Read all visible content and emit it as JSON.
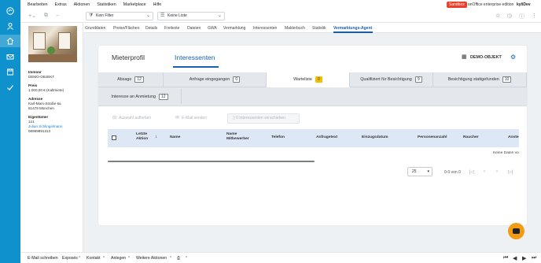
{
  "menubar": {
    "items": [
      "Bearbeiten",
      "Extras",
      "Aktionen",
      "Statistiken",
      "Marketplace",
      "Hilfe"
    ],
    "sandbox": "Sandbox",
    "edition": "onOffice enterprise edition",
    "user": "kyliDev"
  },
  "toolbar": {
    "filter": "Kein Filter",
    "list": "Keine Liste"
  },
  "tabs": [
    "Grunddaten",
    "Preise/Flächen",
    "Details",
    "Freitexte",
    "Dateien",
    "GWA",
    "Vermarktung",
    "Interessenten",
    "Maklerbuch",
    "Statistik",
    "Vermarktungs-Agent"
  ],
  "active_tab": "Vermarktungs-Agent",
  "property": {
    "immonr_label": "Immonr",
    "immonr": "DEMO-OBJEKT",
    "preis_label": "Preis",
    "preis": "1.000,00 € (Kaltmiete)",
    "adresse_label": "Adresse",
    "adresse_1": "Karl-Marx-Straße 6a",
    "adresse_2": "81479 München",
    "eigentuemer_label": "Eigentümer",
    "eig_nr": "121",
    "eig_name": "Julian Schlingelmann",
    "eig_phone": "08989891313"
  },
  "main": {
    "header_tabs": [
      "Mieterprofil",
      "Interessenten"
    ],
    "object_label": "DEMO-OBJEKT"
  },
  "agent_tabs": [
    {
      "label": "Absage",
      "count": "12"
    },
    {
      "label": "Anfrage eingegangen",
      "count": "0"
    },
    {
      "label": "Warteliste",
      "count": "0"
    },
    {
      "label": "Qualifiziert für Besichtigung",
      "count": "9"
    },
    {
      "label": "Besichtigung stattgefunden",
      "count": "10"
    },
    {
      "label": "Interesse an Anmietung",
      "count": "12"
    }
  ],
  "actions": {
    "cancel": "Auswahl aufheben",
    "email": "E-Mail senden",
    "move": "0 Interessenten verschieben"
  },
  "table": {
    "headers": [
      "Letzte Aktion",
      "Name",
      "Name Mitbewerber",
      "Telefon",
      "Anfragetext",
      "Einzugsdatum",
      "Personenanzahl",
      "Raucher",
      "Anste"
    ],
    "nodata": "Keine Daten vo"
  },
  "pager": {
    "size": "25",
    "range": "0-0 von 0"
  },
  "bottom": {
    "items": [
      "E-Mail schreiben",
      "Exposés",
      "Kontakt",
      "Anlegen",
      "Weitere Aktionen"
    ]
  }
}
